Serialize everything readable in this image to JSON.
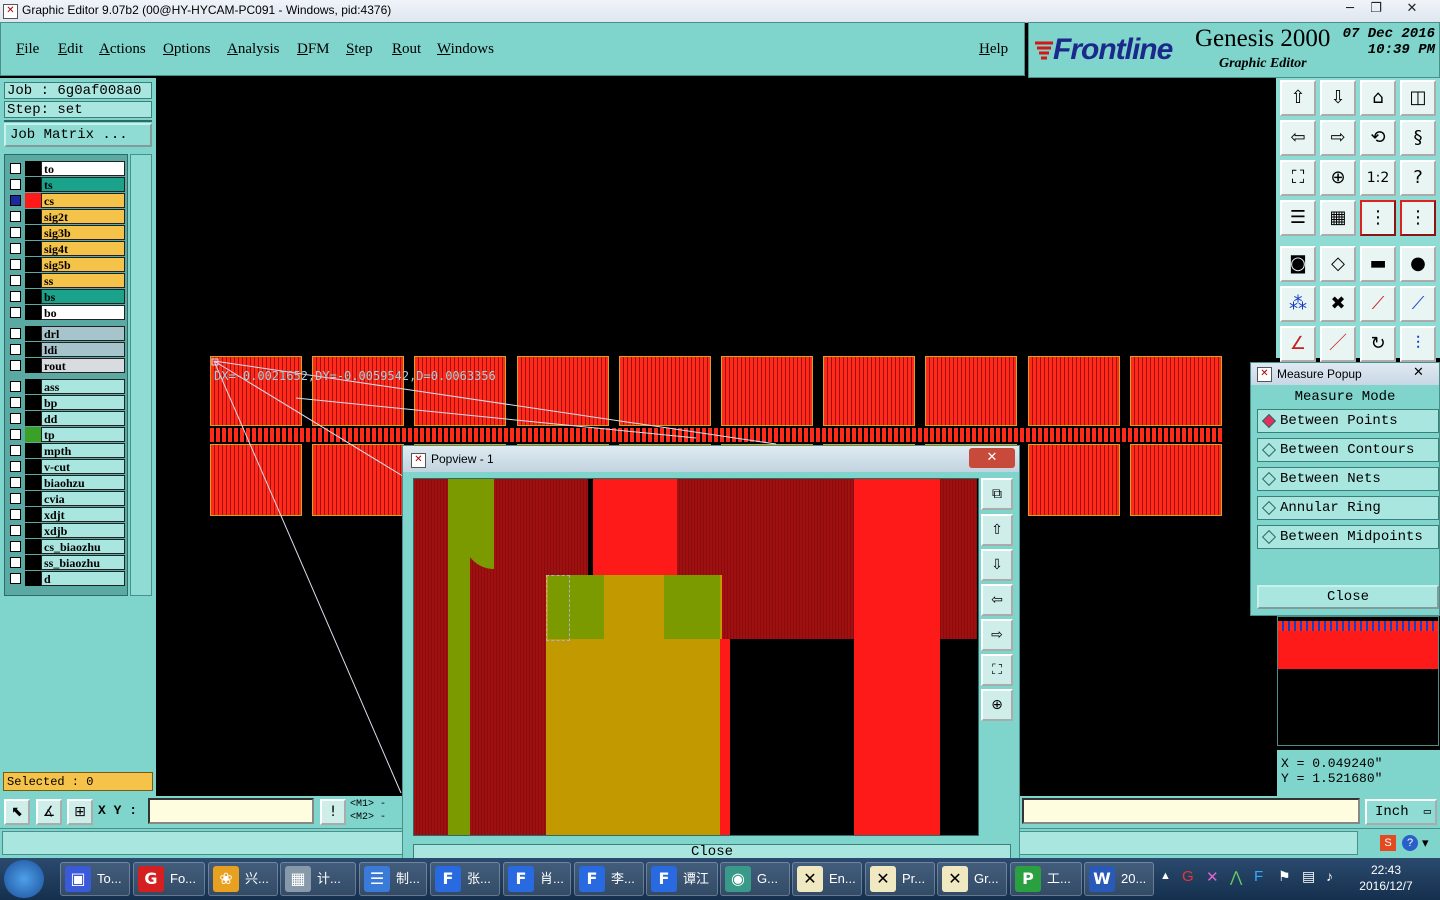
{
  "window": {
    "title": "Graphic Editor 9.07b2 (00@HY-HYCAM-PC091 - Windows, pid:4376)",
    "buttons": {
      "minimize": "─",
      "maximize": "❐",
      "close": "✕"
    }
  },
  "menu": [
    "File",
    "Edit",
    "Actions",
    "Options",
    "Analysis",
    "DFM",
    "Step",
    "Rout",
    "Windows"
  ],
  "help": "Help",
  "logo": {
    "brand": "Frontline",
    "product": "Genesis 2000",
    "subtitle": "Graphic Editor",
    "date": "07 Dec 2016",
    "time": "10:39 PM"
  },
  "job": {
    "job_line": "Job : 6g0af008a0",
    "step_line": "Step: set",
    "matrix_button": "Job Matrix ..."
  },
  "layers": [
    {
      "name": "to",
      "color": "#ffffff",
      "swatch": "#000000",
      "checked": false
    },
    {
      "name": "ts",
      "color": "#1aa38a",
      "swatch": "#000000",
      "checked": false
    },
    {
      "name": "cs",
      "color": "#f5c34a",
      "swatch": "#ff1a1a",
      "checked": true
    },
    {
      "name": "sig2t",
      "color": "#f5c34a",
      "swatch": "#000000",
      "checked": false
    },
    {
      "name": "sig3b",
      "color": "#f5c34a",
      "swatch": "#000000",
      "checked": false
    },
    {
      "name": "sig4t",
      "color": "#f5c34a",
      "swatch": "#000000",
      "checked": false
    },
    {
      "name": "sig5b",
      "color": "#f5c34a",
      "swatch": "#000000",
      "checked": false
    },
    {
      "name": "ss",
      "color": "#f5c34a",
      "swatch": "#000000",
      "checked": false
    },
    {
      "name": "bs",
      "color": "#1aa38a",
      "swatch": "#000000",
      "checked": false
    },
    {
      "name": "bo",
      "color": "#ffffff",
      "swatch": "#000000",
      "checked": false
    },
    {
      "name": "drl",
      "color": "#a7c3cc",
      "swatch": "#000000",
      "checked": false
    },
    {
      "name": "ldi",
      "color": "#a7c3cc",
      "swatch": "#000000",
      "checked": false
    },
    {
      "name": "rout",
      "color": "#d8dce0",
      "swatch": "#000000",
      "checked": false
    },
    {
      "name": "ass",
      "color": "#a9e6df",
      "swatch": "#000000",
      "checked": false
    },
    {
      "name": "bp",
      "color": "#a9e6df",
      "swatch": "#000000",
      "checked": false
    },
    {
      "name": "dd",
      "color": "#a9e6df",
      "swatch": "#000000",
      "checked": false
    },
    {
      "name": "tp",
      "color": "#a9e6df",
      "swatch": "#3aa028",
      "checked": false
    },
    {
      "name": "mpth",
      "color": "#a9e6df",
      "swatch": "#000000",
      "checked": false
    },
    {
      "name": "v-cut",
      "color": "#a9e6df",
      "swatch": "#000000",
      "checked": false
    },
    {
      "name": "biaohzu",
      "color": "#a9e6df",
      "swatch": "#000000",
      "checked": false
    },
    {
      "name": "cvia",
      "color": "#a9e6df",
      "swatch": "#000000",
      "checked": false
    },
    {
      "name": "xdjt",
      "color": "#a9e6df",
      "swatch": "#000000",
      "checked": false
    },
    {
      "name": "xdjb",
      "color": "#a9e6df",
      "swatch": "#000000",
      "checked": false
    },
    {
      "name": "cs_biaozhu",
      "color": "#a9e6df",
      "swatch": "#000000",
      "checked": false
    },
    {
      "name": "ss_biaozhu",
      "color": "#a9e6df",
      "swatch": "#000000",
      "checked": false
    },
    {
      "name": "d",
      "color": "#a9e6df",
      "swatch": "#000000",
      "checked": false
    }
  ],
  "selected": "Selected : 0",
  "canvas": {
    "measure_readout": "DX=-0.0021652,DY=-0.0059542,D=0.0063356"
  },
  "measure_popup": {
    "title": "Measure Popup",
    "heading": "Measure Mode",
    "options": [
      "Between Points",
      "Between Contours",
      "Between Nets",
      "Annular Ring",
      "Between Midpoints"
    ],
    "selected_option": "Between Points",
    "close": "Close"
  },
  "coords": {
    "x": "X = 0.049240\"",
    "y": "Y = 1.521680\""
  },
  "bottom": {
    "xy_label": "X Y :",
    "xy_value": "",
    "m1": "<M1> -",
    "m2": "<M2> -",
    "unit": "Inch"
  },
  "popview": {
    "title": "Popview - 1",
    "close": "Close"
  },
  "taskbar": {
    "items": [
      {
        "label": "To...",
        "icon": "save-disk-icon"
      },
      {
        "label": "Fo...",
        "icon": "g-logo-icon"
      },
      {
        "label": "兴...",
        "icon": "shell-icon"
      },
      {
        "label": "计...",
        "icon": "calculator-icon"
      },
      {
        "label": "制...",
        "icon": "notepad-icon"
      },
      {
        "label": "张...",
        "icon": "frontline-f-icon"
      },
      {
        "label": "肖...",
        "icon": "frontline-f-icon"
      },
      {
        "label": "李...",
        "icon": "frontline-f-icon"
      },
      {
        "label": "谭江",
        "icon": "frontline-f-icon"
      },
      {
        "label": "G...",
        "icon": "genesis-eye-icon"
      },
      {
        "label": "En...",
        "icon": "x-window-icon"
      },
      {
        "label": "Pr...",
        "icon": "x-window-icon"
      },
      {
        "label": "Gr...",
        "icon": "x-window-icon"
      },
      {
        "label": "工...",
        "icon": "green-p-icon"
      },
      {
        "label": "20...",
        "icon": "word-doc-icon"
      }
    ],
    "clock_time": "22:43",
    "clock_date": "2016/12/7"
  },
  "colors": {
    "chrome": "#7fd4cc",
    "copper_red": "#ff1a1a",
    "copper_dark": "#a01010",
    "pad_gold": "#c29a00",
    "olive": "#7a9a00"
  }
}
